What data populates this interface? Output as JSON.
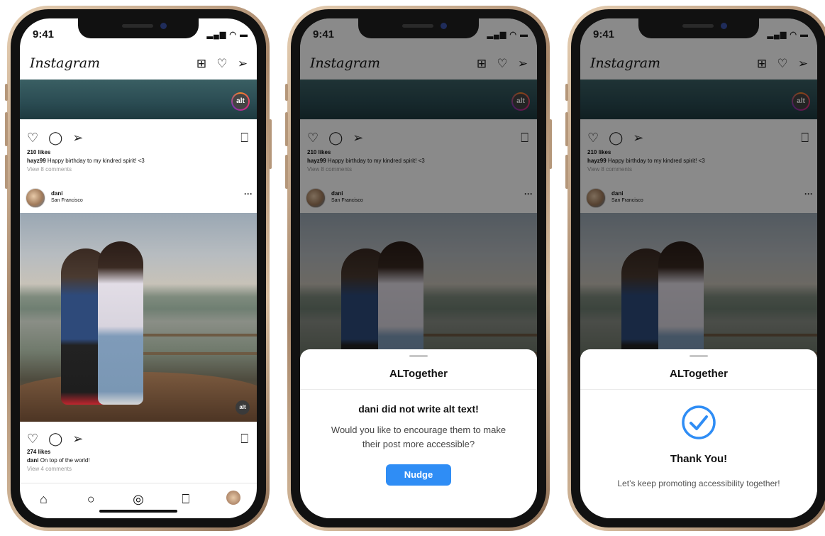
{
  "status": {
    "time": "9:41",
    "indicators": "..ıl ᯤ ▬"
  },
  "app": {
    "logo": "Instagram",
    "icons": [
      "new-post-icon",
      "heart-icon",
      "direct-message-icon"
    ]
  },
  "post1": {
    "likes": "210 likes",
    "user": "hayz99",
    "caption": "Happy birthday to my kindred spirit! <3",
    "comments": "View 8 comments",
    "alt_label": "alt"
  },
  "post2": {
    "user": "dani",
    "location": "San Francisco",
    "more": "···",
    "alt_label": "alt",
    "likes": "274 likes",
    "caption": "On top of the world!",
    "comments": "View 4 comments"
  },
  "tabbar": {
    "items": [
      "home-icon",
      "search-icon",
      "camera-icon",
      "saved-icon",
      "profile-avatar"
    ]
  },
  "sheet_nudge": {
    "title": "ALTogether",
    "heading": "dani did not write alt text!",
    "body": "Would you like to encourage them to make their post more accessible?",
    "button": "Nudge"
  },
  "sheet_thanks": {
    "title": "ALTogether",
    "heading": "Thank You!",
    "body": "Let’s keep promoting accessibility together!"
  },
  "colors": {
    "accent": "#2f8df5",
    "dim": "rgba(0,0,0,0.46)"
  }
}
